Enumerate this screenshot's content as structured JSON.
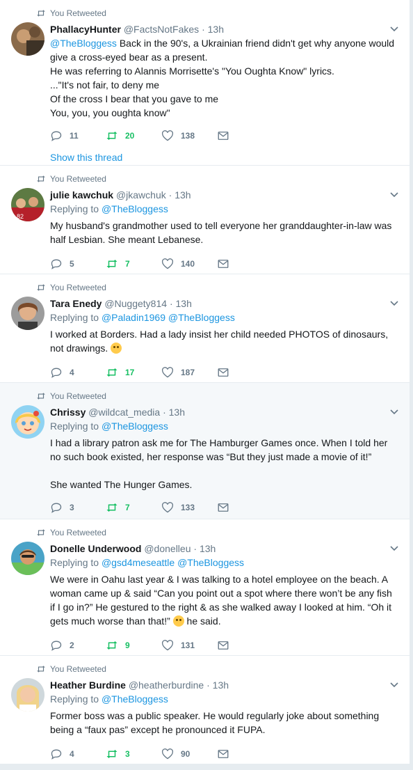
{
  "retweet_context": "You Retweeted",
  "tweets": [
    {
      "name": "PhallacyHunter",
      "handle": "@FactsNotFakes",
      "time": "13h",
      "replying_prefix": "",
      "replying_to": "",
      "lines": [
        "@TheBloggess Back in the 90's, a Ukrainian friend didn't get why anyone would",
        "give a cross-eyed bear as a present.",
        "He was referring to Alannis Morrisette's \"You Oughta Know\" lyrics.",
        "...\"It's not fair, to deny me",
        "Of the cross I bear that you gave to me",
        "You, you, you oughta know\""
      ],
      "replies": "11",
      "retweets": "20",
      "likes": "138",
      "show_thread": "Show this thread"
    },
    {
      "name": "julie kawchuk",
      "handle": "@jkawchuk",
      "time": "13h",
      "replying_prefix": "Replying to",
      "replying_to": "@TheBloggess",
      "lines": [
        "My husband's grandmother used to tell everyone her granddaughter-in-law was",
        "half Lesbian.  She meant Lebanese."
      ],
      "replies": "5",
      "retweets": "7",
      "likes": "140"
    },
    {
      "name": "Tara Enedy",
      "handle": "@Nuggety814",
      "time": "13h",
      "replying_prefix": "Replying to",
      "replying_to": "@Paladin1969 @TheBloggess",
      "lines": [
        "I worked at Borders.  Had a lady insist her child needed PHOTOS of dinosaurs,",
        "not drawings."
      ],
      "replies": "4",
      "retweets": "17",
      "likes": "187"
    },
    {
      "name": "Chrissy",
      "handle": "@wildcat_media",
      "time": "13h",
      "replying_prefix": "Replying to",
      "replying_to": "@TheBloggess",
      "lines": [
        "I had a library patron ask me for The Hamburger Games once. When I told her",
        "no such book existed, her response was “But they just made a movie of it!”",
        "",
        "She wanted The Hunger Games."
      ],
      "replies": "3",
      "retweets": "7",
      "likes": "133"
    },
    {
      "name": "Donelle Underwood",
      "handle": "@donelleu",
      "time": "13h",
      "replying_prefix": "Replying to",
      "replying_to": "@gsd4meseattle @TheBloggess",
      "lines": [
        "We were in Oahu last year & I was talking to a hotel employee on the beach. A",
        "woman came up & said “Can you point out a spot where there won’t be any fish",
        "if I go in?” He gestured to the right & as she walked away I looked at him. “Oh it",
        "gets much worse than that!”",
        "he said."
      ],
      "replies": "2",
      "retweets": "9",
      "likes": "131"
    },
    {
      "name": "Heather Burdine",
      "handle": "@heatherburdine",
      "time": "13h",
      "replying_prefix": "Replying to",
      "replying_to": "@TheBloggess",
      "lines": [
        "Former boss was a public speaker. He would regularly joke about something",
        "being a “faux pas” except he pronounced it FUPA."
      ],
      "replies": "4",
      "retweets": "3",
      "likes": "90"
    }
  ],
  "colors": {
    "link": "#1b95e0",
    "retweet_green": "#17bf63",
    "muted": "#657786"
  }
}
